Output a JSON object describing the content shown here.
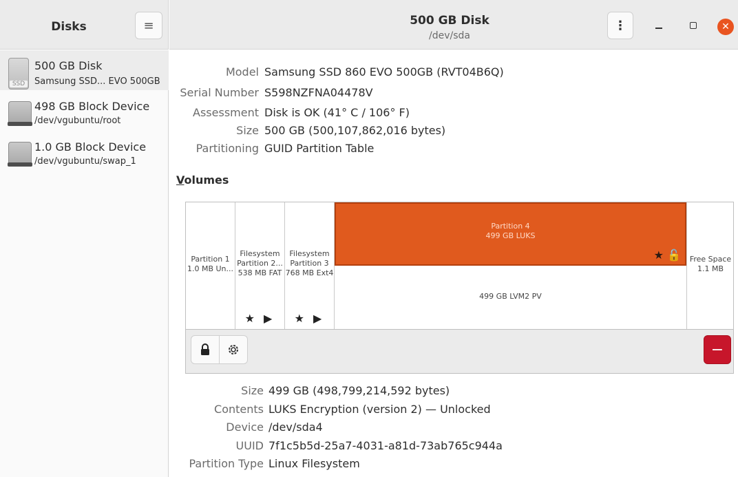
{
  "sidebar_header": {
    "title": "Disks",
    "menu_icon": "hamburger-menu-icon"
  },
  "header": {
    "title": "500 GB Disk",
    "subtitle": "/dev/sda",
    "menu_icon": "vertical-ellipsis-icon"
  },
  "window_controls": {
    "minimize": "minimize-icon",
    "maximize": "maximize-icon",
    "close": "close-icon",
    "close_color": "#e95420"
  },
  "sidebar": {
    "devices": [
      {
        "name": "500 GB Disk",
        "sub": "Samsung SSD...  EVO 500GB",
        "icon": "ssd-icon",
        "icon_label": "SSD",
        "selected": true
      },
      {
        "name": "498 GB Block Device",
        "sub": "/dev/vgubuntu/root",
        "icon": "block-device-icon"
      },
      {
        "name": "1.0 GB Block Device",
        "sub": "/dev/vgubuntu/swap_1",
        "icon": "block-device-icon"
      }
    ]
  },
  "disk_info": [
    {
      "key": "Model",
      "value": "Samsung SSD 860 EVO 500GB (RVT04B6Q)"
    },
    {
      "key": "Serial Number",
      "value": "S598NZFNA04478V"
    },
    {
      "key": "Assessment",
      "value": "Disk is OK (41° C / 106° F)"
    },
    {
      "key": "Size",
      "value": "500 GB (500,107,862,016 bytes)"
    },
    {
      "key": "Partitioning",
      "value": "GUID Partition Table"
    }
  ],
  "volumes": {
    "title_first": "V",
    "title_rest": "olumes",
    "partitions": [
      {
        "line1": "Partition 1",
        "line2": "1.0 MB Un..."
      },
      {
        "line1": "Filesystem",
        "line2": "Partition 2...",
        "line3": "538 MB FAT",
        "marks": "★ ▶"
      },
      {
        "line1": "Filesystem",
        "line2": "Partition 3",
        "line3": "768 MB Ext4",
        "marks": "★ ▶"
      },
      {
        "line1": "Partition 4",
        "line2": "499 GB LUKS",
        "marks": "★",
        "lock": "🔓",
        "color": "#e05a1e",
        "inner": "499 GB LVM2 PV"
      },
      {
        "line1": "Free Space",
        "line2": "1.1 MB"
      }
    ],
    "toolbar": {
      "lock_icon": "lock-icon",
      "gear_icon": "gear-icon",
      "remove_icon": "minus-icon",
      "remove_color": "#c7162b",
      "remove_label": "−"
    }
  },
  "volume_info": [
    {
      "key": "Size",
      "value": "499 GB (498,799,214,592 bytes)"
    },
    {
      "key": "Contents",
      "value": "LUKS Encryption (version 2) — Unlocked"
    },
    {
      "key": "Device",
      "value": "/dev/sda4"
    },
    {
      "key": "UUID",
      "value": "7f1c5b5d-25a7-4031-a81d-73ab765c944a"
    },
    {
      "key": "Partition Type",
      "value": "Linux Filesystem"
    }
  ]
}
